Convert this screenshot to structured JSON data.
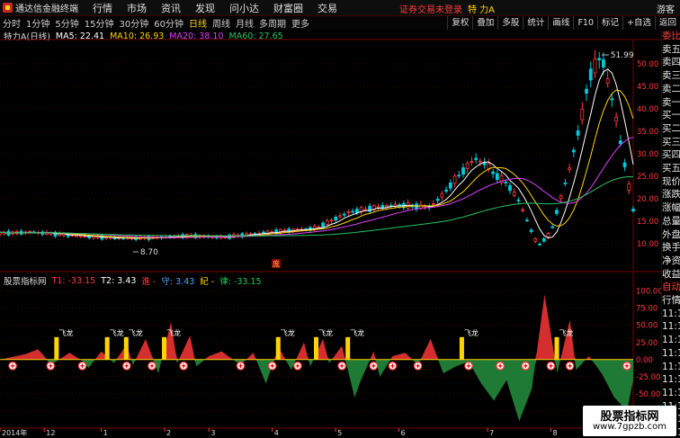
{
  "colors": {
    "up": "#ff3b3b",
    "down": "#00c8d8",
    "ma5": "#ffffff",
    "ma10": "#ffd400",
    "ma20": "#e040fb",
    "ma60": "#22c55e",
    "red_area": "#d42e2e",
    "green_area": "#1e7a34",
    "signal": "#ffd400",
    "grid": "#7a0000"
  },
  "app": {
    "title": "通达信金融终端",
    "menu": [
      "行情",
      "市场",
      "资讯",
      "发现",
      "问小达",
      "财富圈",
      "交易"
    ],
    "notice": "证券交易未登录",
    "stock": "特 力A",
    "guest": "游客"
  },
  "periods": [
    "分时",
    "1分钟",
    "5分钟",
    "15分钟",
    "30分钟",
    "60分钟",
    "日线",
    "周线",
    "月线",
    "多周期",
    "更多"
  ],
  "tools": [
    "复权",
    "叠加",
    "多股",
    "统计",
    "画线",
    "F10",
    "标记",
    "+自选",
    "返回"
  ],
  "legend": {
    "stock": "特力A(日线)",
    "ma5": "MA5: 22.41",
    "ma10": "MA10: 26.93",
    "ma20": "MA20: 38.10",
    "ma60": "MA60: 27.65"
  },
  "indicator": {
    "name": "股票指标网",
    "t1": "T1: -33.15",
    "t2": "T2: 3.43",
    "jin": "進 -",
    "shou": "守: 3.43",
    "ji": "紀 -",
    "lv": "律: -33.15",
    "signal_text": "飞龙"
  },
  "sidebar_labels": [
    "委比",
    "卖五",
    "卖四",
    "卖三",
    "卖二",
    "卖一",
    "买一",
    "买二",
    "买三",
    "买四",
    "买五",
    "现价",
    "涨跌",
    "涨幅",
    "总量",
    "外盘",
    "换手",
    "净资",
    "收益"
  ],
  "sidebar_bottom": [
    "自动",
    "行情",
    "11:1",
    "11:1",
    "11:1",
    "11:1",
    "11:1",
    "11:1",
    "11:1",
    "11:1",
    "11:1",
    "11:1"
  ],
  "price_axis": [
    "50.00",
    "45.00",
    "40.00",
    "35.00",
    "30.00",
    "25.00",
    "20.00",
    "15.00",
    "10.00"
  ],
  "ind_axis": [
    "100.00",
    "75.00",
    "50.00",
    "25.00",
    "0.00",
    "-25.00",
    "-50.00",
    "-75.00"
  ],
  "chart_data": {
    "type": "line",
    "title": "特力A(日线)",
    "annotations": {
      "high": "51.99",
      "low": "8.70",
      "marker": "庞"
    },
    "x_ticks": [
      "2014年",
      "12",
      "1",
      "2",
      "3",
      "4",
      "5",
      "6",
      "7",
      "8"
    ],
    "price_x": [
      0,
      5,
      10,
      15,
      20,
      25,
      30,
      35,
      40,
      45,
      50,
      52,
      55,
      60,
      63,
      65,
      68,
      70,
      72,
      74,
      75,
      77,
      78,
      80,
      82,
      84,
      85,
      87,
      88,
      90,
      92,
      93,
      95,
      97,
      100
    ],
    "price_y": [
      12.3,
      12.6,
      12.0,
      11.5,
      11.2,
      11.4,
      11.8,
      11.4,
      12.2,
      12.9,
      13.5,
      14.9,
      17.0,
      18.2,
      18.6,
      18.4,
      18.2,
      21.0,
      24.5,
      27.5,
      29.0,
      27.5,
      25.5,
      23.5,
      19.5,
      12.5,
      9.5,
      12.5,
      17.5,
      27.0,
      39.0,
      47.0,
      51.99,
      40.0,
      17.5
    ],
    "indicator_x": [
      0,
      4,
      6,
      7,
      8,
      11,
      13,
      14,
      16,
      18,
      20,
      21,
      23,
      25,
      27,
      28,
      30,
      31,
      33,
      35,
      38,
      40,
      42,
      44,
      46,
      48,
      49,
      51,
      52,
      54,
      56,
      57,
      59,
      60,
      62,
      64,
      66,
      68,
      70,
      72,
      74,
      76,
      78,
      80,
      82,
      84,
      86,
      88,
      90,
      91,
      93,
      95,
      97,
      99,
      100
    ],
    "indicator_y": [
      0,
      8,
      15,
      5,
      -8,
      10,
      -2,
      -12,
      12,
      -5,
      22,
      -8,
      30,
      -20,
      55,
      -5,
      35,
      -10,
      5,
      12,
      -8,
      10,
      -35,
      18,
      -15,
      25,
      -10,
      30,
      -5,
      20,
      -55,
      -30,
      12,
      -25,
      5,
      10,
      -8,
      30,
      -20,
      -10,
      -3,
      -35,
      -60,
      -30,
      -90,
      -42,
      95,
      -20,
      58,
      -15,
      5,
      -20,
      -55,
      -75,
      -30
    ],
    "signals": [
      {
        "x": 9
      },
      {
        "x": 17
      },
      {
        "x": 20
      },
      {
        "x": 26
      },
      {
        "x": 44
      },
      {
        "x": 50
      },
      {
        "x": 55
      },
      {
        "x": 73
      },
      {
        "x": 88
      }
    ],
    "ylim_price": [
      5,
      55
    ],
    "ylim_indicator": [
      -100,
      110
    ]
  }
}
